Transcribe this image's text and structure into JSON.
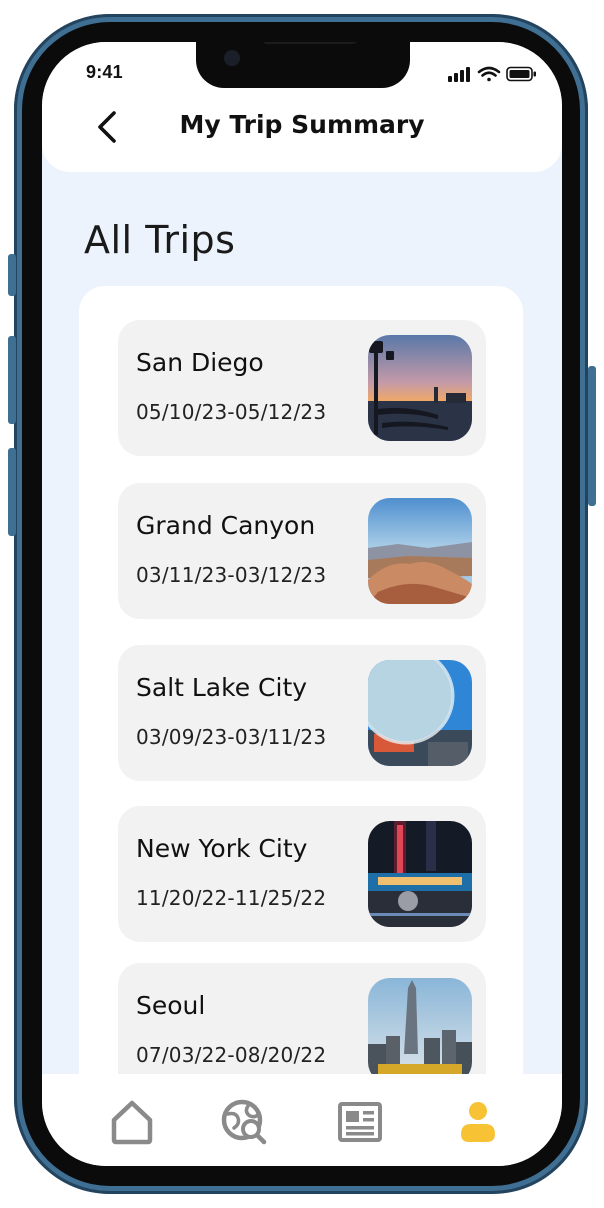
{
  "status": {
    "time": "9:41"
  },
  "header": {
    "title": "My Trip Summary"
  },
  "section": {
    "title": "All Trips"
  },
  "trips": [
    {
      "name": "San Diego",
      "dates": "05/10/23-05/12/23"
    },
    {
      "name": "Grand Canyon",
      "dates": "03/11/23-03/12/23"
    },
    {
      "name": "Salt Lake City",
      "dates": "03/09/23-03/11/23"
    },
    {
      "name": "New York City",
      "dates": "11/20/22-11/25/22"
    },
    {
      "name": "Seoul",
      "dates": "07/03/22-08/20/22"
    }
  ],
  "nav": {
    "items": [
      "home-icon",
      "explore-globe-search-icon",
      "news-icon",
      "profile-icon"
    ],
    "active": "profile-icon",
    "active_color": "#f7c234",
    "inactive_color": "#8a8a8a"
  },
  "colors": {
    "frame": "#3f6f93",
    "background": "#edf3fc",
    "card": "#f2f2f2"
  }
}
